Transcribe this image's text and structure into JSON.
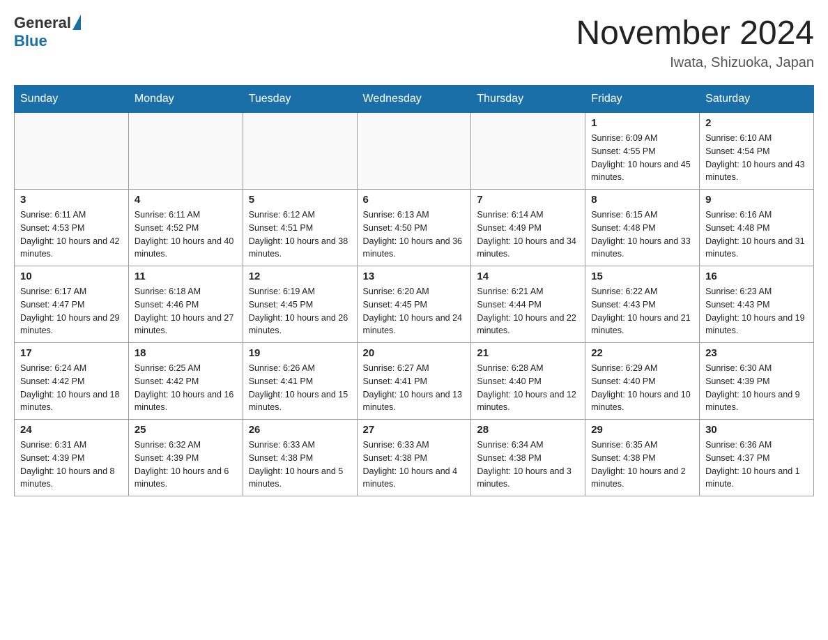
{
  "header": {
    "logo_general": "General",
    "logo_blue": "Blue",
    "month_title": "November 2024",
    "location": "Iwata, Shizuoka, Japan"
  },
  "weekdays": [
    "Sunday",
    "Monday",
    "Tuesday",
    "Wednesday",
    "Thursday",
    "Friday",
    "Saturday"
  ],
  "weeks": [
    [
      {
        "day": "",
        "info": ""
      },
      {
        "day": "",
        "info": ""
      },
      {
        "day": "",
        "info": ""
      },
      {
        "day": "",
        "info": ""
      },
      {
        "day": "",
        "info": ""
      },
      {
        "day": "1",
        "info": "Sunrise: 6:09 AM\nSunset: 4:55 PM\nDaylight: 10 hours and 45 minutes."
      },
      {
        "day": "2",
        "info": "Sunrise: 6:10 AM\nSunset: 4:54 PM\nDaylight: 10 hours and 43 minutes."
      }
    ],
    [
      {
        "day": "3",
        "info": "Sunrise: 6:11 AM\nSunset: 4:53 PM\nDaylight: 10 hours and 42 minutes."
      },
      {
        "day": "4",
        "info": "Sunrise: 6:11 AM\nSunset: 4:52 PM\nDaylight: 10 hours and 40 minutes."
      },
      {
        "day": "5",
        "info": "Sunrise: 6:12 AM\nSunset: 4:51 PM\nDaylight: 10 hours and 38 minutes."
      },
      {
        "day": "6",
        "info": "Sunrise: 6:13 AM\nSunset: 4:50 PM\nDaylight: 10 hours and 36 minutes."
      },
      {
        "day": "7",
        "info": "Sunrise: 6:14 AM\nSunset: 4:49 PM\nDaylight: 10 hours and 34 minutes."
      },
      {
        "day": "8",
        "info": "Sunrise: 6:15 AM\nSunset: 4:48 PM\nDaylight: 10 hours and 33 minutes."
      },
      {
        "day": "9",
        "info": "Sunrise: 6:16 AM\nSunset: 4:48 PM\nDaylight: 10 hours and 31 minutes."
      }
    ],
    [
      {
        "day": "10",
        "info": "Sunrise: 6:17 AM\nSunset: 4:47 PM\nDaylight: 10 hours and 29 minutes."
      },
      {
        "day": "11",
        "info": "Sunrise: 6:18 AM\nSunset: 4:46 PM\nDaylight: 10 hours and 27 minutes."
      },
      {
        "day": "12",
        "info": "Sunrise: 6:19 AM\nSunset: 4:45 PM\nDaylight: 10 hours and 26 minutes."
      },
      {
        "day": "13",
        "info": "Sunrise: 6:20 AM\nSunset: 4:45 PM\nDaylight: 10 hours and 24 minutes."
      },
      {
        "day": "14",
        "info": "Sunrise: 6:21 AM\nSunset: 4:44 PM\nDaylight: 10 hours and 22 minutes."
      },
      {
        "day": "15",
        "info": "Sunrise: 6:22 AM\nSunset: 4:43 PM\nDaylight: 10 hours and 21 minutes."
      },
      {
        "day": "16",
        "info": "Sunrise: 6:23 AM\nSunset: 4:43 PM\nDaylight: 10 hours and 19 minutes."
      }
    ],
    [
      {
        "day": "17",
        "info": "Sunrise: 6:24 AM\nSunset: 4:42 PM\nDaylight: 10 hours and 18 minutes."
      },
      {
        "day": "18",
        "info": "Sunrise: 6:25 AM\nSunset: 4:42 PM\nDaylight: 10 hours and 16 minutes."
      },
      {
        "day": "19",
        "info": "Sunrise: 6:26 AM\nSunset: 4:41 PM\nDaylight: 10 hours and 15 minutes."
      },
      {
        "day": "20",
        "info": "Sunrise: 6:27 AM\nSunset: 4:41 PM\nDaylight: 10 hours and 13 minutes."
      },
      {
        "day": "21",
        "info": "Sunrise: 6:28 AM\nSunset: 4:40 PM\nDaylight: 10 hours and 12 minutes."
      },
      {
        "day": "22",
        "info": "Sunrise: 6:29 AM\nSunset: 4:40 PM\nDaylight: 10 hours and 10 minutes."
      },
      {
        "day": "23",
        "info": "Sunrise: 6:30 AM\nSunset: 4:39 PM\nDaylight: 10 hours and 9 minutes."
      }
    ],
    [
      {
        "day": "24",
        "info": "Sunrise: 6:31 AM\nSunset: 4:39 PM\nDaylight: 10 hours and 8 minutes."
      },
      {
        "day": "25",
        "info": "Sunrise: 6:32 AM\nSunset: 4:39 PM\nDaylight: 10 hours and 6 minutes."
      },
      {
        "day": "26",
        "info": "Sunrise: 6:33 AM\nSunset: 4:38 PM\nDaylight: 10 hours and 5 minutes."
      },
      {
        "day": "27",
        "info": "Sunrise: 6:33 AM\nSunset: 4:38 PM\nDaylight: 10 hours and 4 minutes."
      },
      {
        "day": "28",
        "info": "Sunrise: 6:34 AM\nSunset: 4:38 PM\nDaylight: 10 hours and 3 minutes."
      },
      {
        "day": "29",
        "info": "Sunrise: 6:35 AM\nSunset: 4:38 PM\nDaylight: 10 hours and 2 minutes."
      },
      {
        "day": "30",
        "info": "Sunrise: 6:36 AM\nSunset: 4:37 PM\nDaylight: 10 hours and 1 minute."
      }
    ]
  ]
}
